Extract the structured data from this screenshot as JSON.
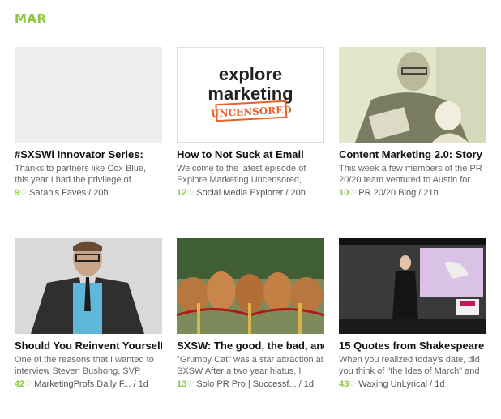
{
  "month": "MAR",
  "cards": [
    {
      "title": "#SXSWi Innovator Series:",
      "excerpt": "Thanks to partners like Cox Blue, this year I had the privilege of",
      "count": "9",
      "source": "Sarah's Faves",
      "age": "20h"
    },
    {
      "title": "How to Not Suck at Email",
      "excerpt": "Welcome to the latest episode of Explore Marketing Uncensored,",
      "count": "12",
      "source": "Social Media Explorer",
      "age": "20h",
      "logo": {
        "line1": "explore",
        "line2": "marketing",
        "stamp": "UNCENSORED"
      }
    },
    {
      "title": "Content Marketing 2.0: Story +",
      "excerpt": "This week a few members of the PR 20/20 team ventured to Austin for",
      "count": "10",
      "source": "PR 20/20 Blog",
      "age": "21h"
    },
    {
      "title": "Should You Reinvent Yourself?",
      "excerpt": "One of the reasons that I wanted to interview Steven Bushong, SVP",
      "count": "42",
      "source": "MarketingProfs Daily F...",
      "age": "1d"
    },
    {
      "title": "SXSW: The good, the bad, and",
      "excerpt": "\"Grumpy Cat\" was a star attraction at SXSW After a two year hiatus, I",
      "count": "13",
      "source": "Solo PR Pro | Successf...",
      "age": "1d"
    },
    {
      "title": "15 Quotes from Shakespeare",
      "excerpt": "When you realized today's date, did you think of \"the Ides of March\" and",
      "count": "43",
      "source": "Waxing UnLyrical",
      "age": "1d"
    }
  ],
  "colors": {
    "accent": "#8cc63f",
    "stamp": "#e8622c"
  }
}
